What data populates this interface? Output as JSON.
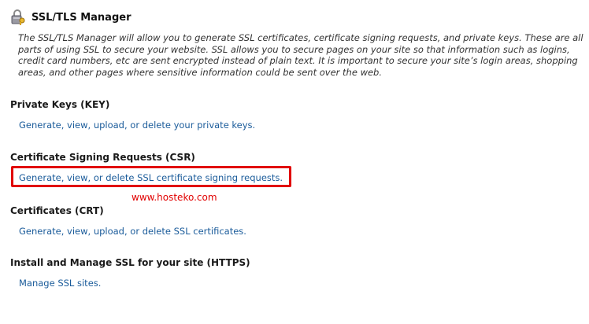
{
  "header": {
    "title": "SSL/TLS Manager",
    "icon": "lock-key-icon"
  },
  "description": "The SSL/TLS Manager will allow you to generate SSL certificates, certificate signing requests, and private keys. These are all parts of using SSL to secure your website. SSL allows you to secure pages on your site so that information such as logins, credit card numbers, etc are sent encrypted instead of plain text. It is important to secure your site’s login areas, shopping areas, and other pages where sensitive information could be sent over the web.",
  "sections": [
    {
      "title": "Private Keys (KEY)",
      "link": "Generate, view, upload, or delete your private keys."
    },
    {
      "title": "Certificate Signing Requests (CSR)",
      "link": "Generate, view, or delete SSL certificate signing requests."
    },
    {
      "title": "Certificates (CRT)",
      "link": "Generate, view, upload, or delete SSL certificates."
    },
    {
      "title": "Install and Manage SSL for your site (HTTPS)",
      "link": "Manage SSL sites."
    }
  ],
  "watermark": "www.hosteko.com",
  "colors": {
    "highlight": "#e10000",
    "link": "#1a5b9a"
  }
}
